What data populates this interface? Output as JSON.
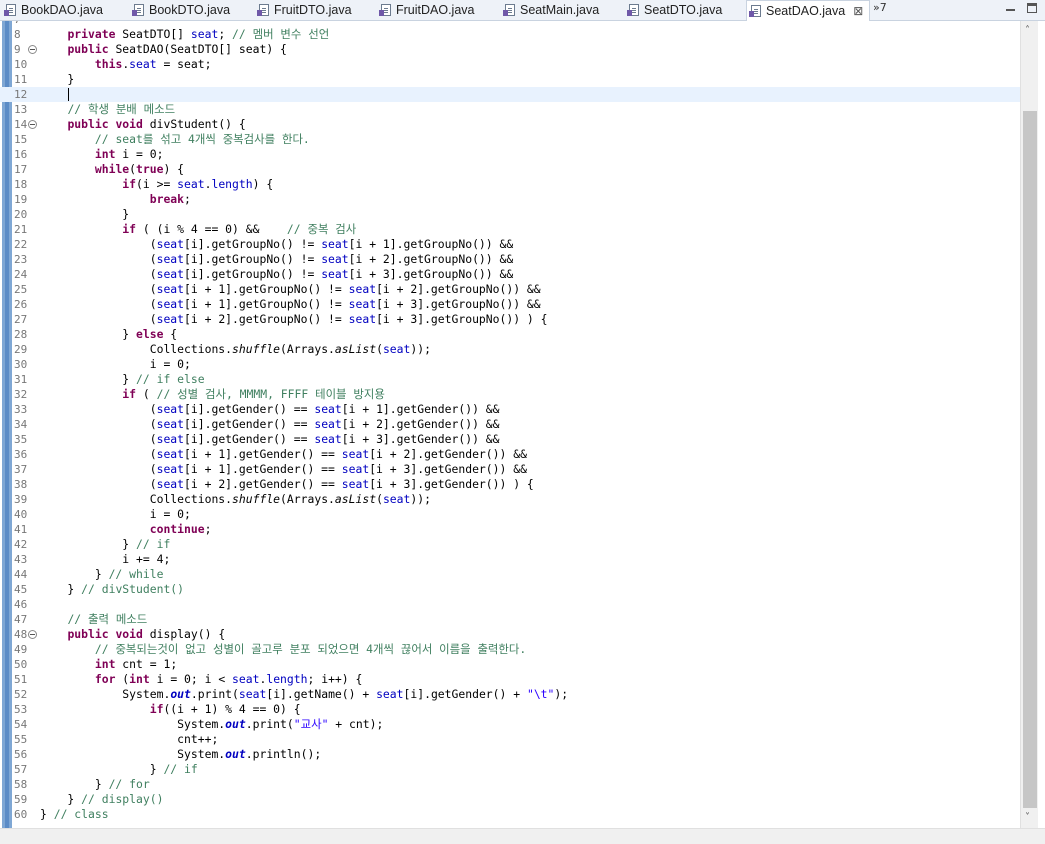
{
  "tabs": [
    {
      "label": "BookDAO.java",
      "active": false
    },
    {
      "label": "BookDTO.java",
      "active": false
    },
    {
      "label": "FruitDTO.java",
      "active": false
    },
    {
      "label": "FruitDAO.java",
      "active": false
    },
    {
      "label": "SeatMain.java",
      "active": false
    },
    {
      "label": "SeatDTO.java",
      "active": false
    },
    {
      "label": "SeatDAO.java",
      "active": true
    }
  ],
  "overflow_label": "»7",
  "close_glyph": "⊠",
  "icons": {
    "file": "java-file-icon",
    "close": "close-icon",
    "fold": "fold-collapse-icon",
    "scroll_up": "chevron-up-icon",
    "scroll_down": "chevron-down-icon"
  },
  "scroll_up_glyph": "˄",
  "scroll_down_glyph": "˅",
  "colors": {
    "keyword": "#7f0055",
    "comment": "#3f7f5f",
    "field": "#0000c0",
    "string": "#2a00ff",
    "current_line": "#e8f2fe"
  },
  "lines": [
    {
      "n": "7",
      "html": ""
    },
    {
      "n": "8",
      "html": "    <span class='kw'>private</span> SeatDTO[] <span class='fd'>seat</span>; <span class='cm'>// 멤버 변수 선언</span>"
    },
    {
      "n": "9",
      "fold": true,
      "html": "    <span class='kw'>public</span> SeatDAO(SeatDTO[] seat) {"
    },
    {
      "n": "10",
      "html": "        <span class='kw'>this</span>.<span class='fd'>seat</span> = seat;"
    },
    {
      "n": "11",
      "html": "    }"
    },
    {
      "n": "12",
      "current": true,
      "caret": true,
      "html": "    "
    },
    {
      "n": "13",
      "html": "    <span class='cm'>// 학생 분배 메소드</span>"
    },
    {
      "n": "14",
      "fold": true,
      "html": "    <span class='kw'>public</span> <span class='kw'>void</span> divStudent() {"
    },
    {
      "n": "15",
      "html": "        <span class='cm'>// seat를 섞고 4개씩 중복검사를 한다.</span>"
    },
    {
      "n": "16",
      "html": "        <span class='kw'>int</span> i = 0;"
    },
    {
      "n": "17",
      "html": "        <span class='kw'>while</span>(<span class='kw'>true</span>) {"
    },
    {
      "n": "18",
      "html": "            <span class='kw'>if</span>(i &gt;= <span class='fd'>seat</span>.<span class='fd'>length</span>) {"
    },
    {
      "n": "19",
      "html": "                <span class='kw'>break</span>;"
    },
    {
      "n": "20",
      "html": "            }"
    },
    {
      "n": "21",
      "html": "            <span class='kw'>if</span> ( (i % 4 == 0) &amp;&amp;    <span class='cm'>// 중복 검사</span>"
    },
    {
      "n": "22",
      "html": "                (<span class='fd'>seat</span>[i].getGroupNo() != <span class='fd'>seat</span>[i + 1].getGroupNo()) &amp;&amp;"
    },
    {
      "n": "23",
      "html": "                (<span class='fd'>seat</span>[i].getGroupNo() != <span class='fd'>seat</span>[i + 2].getGroupNo()) &amp;&amp;"
    },
    {
      "n": "24",
      "html": "                (<span class='fd'>seat</span>[i].getGroupNo() != <span class='fd'>seat</span>[i + 3].getGroupNo()) &amp;&amp;"
    },
    {
      "n": "25",
      "html": "                (<span class='fd'>seat</span>[i + 1].getGroupNo() != <span class='fd'>seat</span>[i + 2].getGroupNo()) &amp;&amp;"
    },
    {
      "n": "26",
      "html": "                (<span class='fd'>seat</span>[i + 1].getGroupNo() != <span class='fd'>seat</span>[i + 3].getGroupNo()) &amp;&amp;"
    },
    {
      "n": "27",
      "html": "                (<span class='fd'>seat</span>[i + 2].getGroupNo() != <span class='fd'>seat</span>[i + 3].getGroupNo()) ) {"
    },
    {
      "n": "28",
      "html": "            } <span class='kw'>else</span> {"
    },
    {
      "n": "29",
      "html": "                Collections.<span class='it'>shuffle</span>(Arrays.<span class='it'>asList</span>(<span class='fd'>seat</span>));"
    },
    {
      "n": "30",
      "html": "                i = 0;"
    },
    {
      "n": "31",
      "html": "            } <span class='cm'>// if else</span>"
    },
    {
      "n": "32",
      "html": "            <span class='kw'>if</span> ( <span class='cm'>// 성별 검사, MMMM, FFFF 테이블 방지용</span>"
    },
    {
      "n": "33",
      "html": "                (<span class='fd'>seat</span>[i].getGender() == <span class='fd'>seat</span>[i + 1].getGender()) &amp;&amp;"
    },
    {
      "n": "34",
      "html": "                (<span class='fd'>seat</span>[i].getGender() == <span class='fd'>seat</span>[i + 2].getGender()) &amp;&amp;"
    },
    {
      "n": "35",
      "html": "                (<span class='fd'>seat</span>[i].getGender() == <span class='fd'>seat</span>[i + 3].getGender()) &amp;&amp;"
    },
    {
      "n": "36",
      "html": "                (<span class='fd'>seat</span>[i + 1].getGender() == <span class='fd'>seat</span>[i + 2].getGender()) &amp;&amp;"
    },
    {
      "n": "37",
      "html": "                (<span class='fd'>seat</span>[i + 1].getGender() == <span class='fd'>seat</span>[i + 3].getGender()) &amp;&amp;"
    },
    {
      "n": "38",
      "html": "                (<span class='fd'>seat</span>[i + 2].getGender() == <span class='fd'>seat</span>[i + 3].getGender()) ) {"
    },
    {
      "n": "39",
      "html": "                Collections.<span class='it'>shuffle</span>(Arrays.<span class='it'>asList</span>(<span class='fd'>seat</span>));"
    },
    {
      "n": "40",
      "html": "                i = 0;"
    },
    {
      "n": "41",
      "html": "                <span class='kw'>continue</span>;"
    },
    {
      "n": "42",
      "html": "            } <span class='cm'>// if</span>"
    },
    {
      "n": "43",
      "html": "            i += 4;"
    },
    {
      "n": "44",
      "html": "        } <span class='cm'>// while</span>"
    },
    {
      "n": "45",
      "html": "    } <span class='cm'>// divStudent()</span>"
    },
    {
      "n": "46",
      "html": ""
    },
    {
      "n": "47",
      "html": "    <span class='cm'>// 출력 메소드</span>"
    },
    {
      "n": "48",
      "fold": true,
      "html": "    <span class='kw'>public</span> <span class='kw'>void</span> display() {"
    },
    {
      "n": "49",
      "html": "        <span class='cm'>// 중복되는것이 없고 성별이 골고루 분포 되었으면 4개씩 끊어서 이름을 출력한다.</span>"
    },
    {
      "n": "50",
      "html": "        <span class='kw'>int</span> cnt = 1;"
    },
    {
      "n": "51",
      "html": "        <span class='kw'>for</span> (<span class='kw'>int</span> i = 0; i &lt; <span class='fd'>seat</span>.<span class='fd'>length</span>; i++) {"
    },
    {
      "n": "52",
      "html": "            System.<span class='sf'>out</span>.print(<span class='fd'>seat</span>[i].getName() + <span class='fd'>seat</span>[i].getGender() + <span class='st'>\"\\t\"</span>);"
    },
    {
      "n": "53",
      "html": "                <span class='kw'>if</span>((i + 1) % 4 == 0) {"
    },
    {
      "n": "54",
      "html": "                    System.<span class='sf'>out</span>.print(<span class='st'>\"교사\"</span> + cnt);"
    },
    {
      "n": "55",
      "html": "                    cnt++;"
    },
    {
      "n": "56",
      "html": "                    System.<span class='sf'>out</span>.println();"
    },
    {
      "n": "57",
      "html": "                } <span class='cm'>// if</span>"
    },
    {
      "n": "58",
      "html": "        } <span class='cm'>// for</span>"
    },
    {
      "n": "59",
      "html": "    } <span class='cm'>// display()</span>"
    },
    {
      "n": "60",
      "html": "} <span class='cm'>// class</span>"
    }
  ]
}
